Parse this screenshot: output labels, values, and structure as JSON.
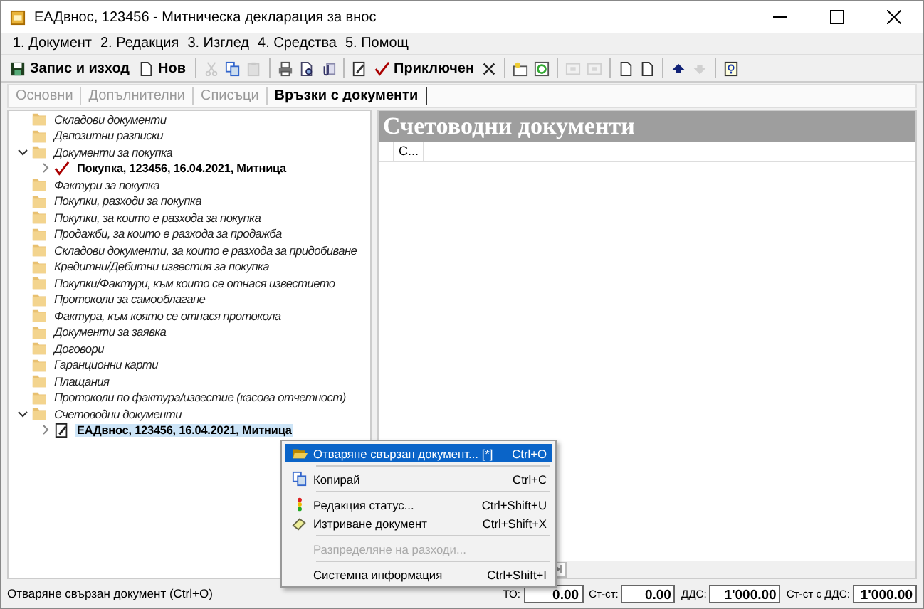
{
  "window": {
    "title": "ЕАДвнос, 123456 - Митническа декларация за внос"
  },
  "menu": [
    "1. Документ",
    "2. Редакция",
    "3. Изглед",
    "4. Средства",
    "5. Помощ"
  ],
  "toolbar": [
    {
      "kind": "button",
      "label": "Запис и изход",
      "disabled": false
    },
    {
      "kind": "button",
      "label": "Нов",
      "disabled": false
    },
    {
      "kind": "sep"
    },
    {
      "kind": "icon",
      "disabled": true
    },
    {
      "kind": "icon",
      "disabled": false
    },
    {
      "kind": "icon",
      "disabled": true
    },
    {
      "kind": "sep"
    },
    {
      "kind": "icon",
      "disabled": false
    },
    {
      "kind": "icon",
      "disabled": false
    },
    {
      "kind": "icon",
      "disabled": false
    },
    {
      "kind": "sep"
    },
    {
      "kind": "icon",
      "disabled": false
    },
    {
      "kind": "button",
      "label": "Приключен",
      "disabled": false
    },
    {
      "kind": "icon",
      "disabled": false
    },
    {
      "kind": "sep"
    },
    {
      "kind": "icon",
      "disabled": false
    },
    {
      "kind": "icon",
      "disabled": false
    },
    {
      "kind": "sep"
    },
    {
      "kind": "icon",
      "disabled": true
    },
    {
      "kind": "icon",
      "disabled": true
    },
    {
      "kind": "sep"
    },
    {
      "kind": "icon",
      "disabled": false
    },
    {
      "kind": "icon",
      "disabled": false
    },
    {
      "kind": "sep"
    },
    {
      "kind": "icon",
      "disabled": false
    },
    {
      "kind": "icon",
      "disabled": true
    },
    {
      "kind": "sep"
    },
    {
      "kind": "icon",
      "disabled": false
    }
  ],
  "tabs": [
    {
      "label": "Основни",
      "selected": false
    },
    {
      "label": "Допълнителни",
      "selected": false
    },
    {
      "label": "Списъци",
      "selected": false
    },
    {
      "label": "Връзки с документи",
      "selected": true
    }
  ],
  "tree": [
    {
      "label": "Складови документи",
      "kind": "folder",
      "selected": false
    },
    {
      "label": "Депозитни разписки",
      "kind": "folder",
      "selected": false
    },
    {
      "label": "Документи за покупка",
      "kind": "folder",
      "selected": false,
      "expanded": true,
      "children": [
        {
          "label": "Покупка, 123456, 16.04.2021, Митница",
          "kind": "tick",
          "selected": false,
          "expanded": false
        }
      ]
    },
    {
      "label": "Фактури за покупка",
      "kind": "folder",
      "selected": false
    },
    {
      "label": "Покупки, разходи за покупка",
      "kind": "folder",
      "selected": false
    },
    {
      "label": "Покупки, за които е разхода за покупка",
      "kind": "folder",
      "selected": false
    },
    {
      "label": "Продажби, за които е разхода за продажба",
      "kind": "folder",
      "selected": false
    },
    {
      "label": "Складови документи, за които е разхода за придобиване",
      "kind": "folder",
      "selected": false
    },
    {
      "label": "Кредитни/Дебитни известия за покупка",
      "kind": "folder",
      "selected": false
    },
    {
      "label": "Покупки/Фактури, към които се отнася известието",
      "kind": "folder",
      "selected": false
    },
    {
      "label": "Протоколи за самооблагане",
      "kind": "folder",
      "selected": false
    },
    {
      "label": "Фактура, към която се отнася протокола",
      "kind": "folder",
      "selected": false
    },
    {
      "label": "Документи за заявка",
      "kind": "folder",
      "selected": false
    },
    {
      "label": "Договори",
      "kind": "folder",
      "selected": false
    },
    {
      "label": "Гаранционни карти",
      "kind": "folder",
      "selected": false
    },
    {
      "label": "Плащания",
      "kind": "folder",
      "selected": false
    },
    {
      "label": "Протоколи по фактура/известие (касова отчетност)",
      "kind": "folder",
      "selected": false
    },
    {
      "label": "Счетоводни документи",
      "kind": "folder",
      "selected": false,
      "expanded": true,
      "children": [
        {
          "label": "ЕАДвнос, 123456, 16.04.2021, Митница",
          "kind": "note",
          "selected": true,
          "expanded": false
        }
      ]
    }
  ],
  "panel": {
    "title": "Счетоводни документи",
    "columns": [
      "С..."
    ]
  },
  "context_menu": [
    {
      "kind": "item",
      "label": "Отваряне свързан документ... [*]",
      "shortcut": "Ctrl+O",
      "selected": true,
      "disabled": false
    },
    {
      "kind": "sep"
    },
    {
      "kind": "item",
      "label": "Копирай",
      "shortcut": "Ctrl+C",
      "selected": false,
      "disabled": false
    },
    {
      "kind": "sep"
    },
    {
      "kind": "item",
      "label": "Редакция статус...",
      "shortcut": "Ctrl+Shift+U",
      "selected": false,
      "disabled": false
    },
    {
      "kind": "item",
      "label": "Изтриване документ",
      "shortcut": "Ctrl+Shift+X",
      "selected": false,
      "disabled": false
    },
    {
      "kind": "sep"
    },
    {
      "kind": "item",
      "label": "Разпределяне на разходи...",
      "selected": false,
      "disabled": true
    },
    {
      "kind": "sep"
    },
    {
      "kind": "item",
      "label": "Системна информация",
      "shortcut": "Ctrl+Shift+I",
      "selected": false,
      "disabled": false
    }
  ],
  "status_bar": {
    "message": "Отваряне свързан документ (Ctrl+O)",
    "fields": [
      {
        "label": "ТО:",
        "value": "0.00"
      },
      {
        "label": "Ст-ст:",
        "value": "0.00"
      },
      {
        "label": "ДДС:",
        "value": "1'000.00"
      },
      {
        "label": "Ст-ст с ДДС:",
        "value": "1'000.00"
      }
    ]
  }
}
